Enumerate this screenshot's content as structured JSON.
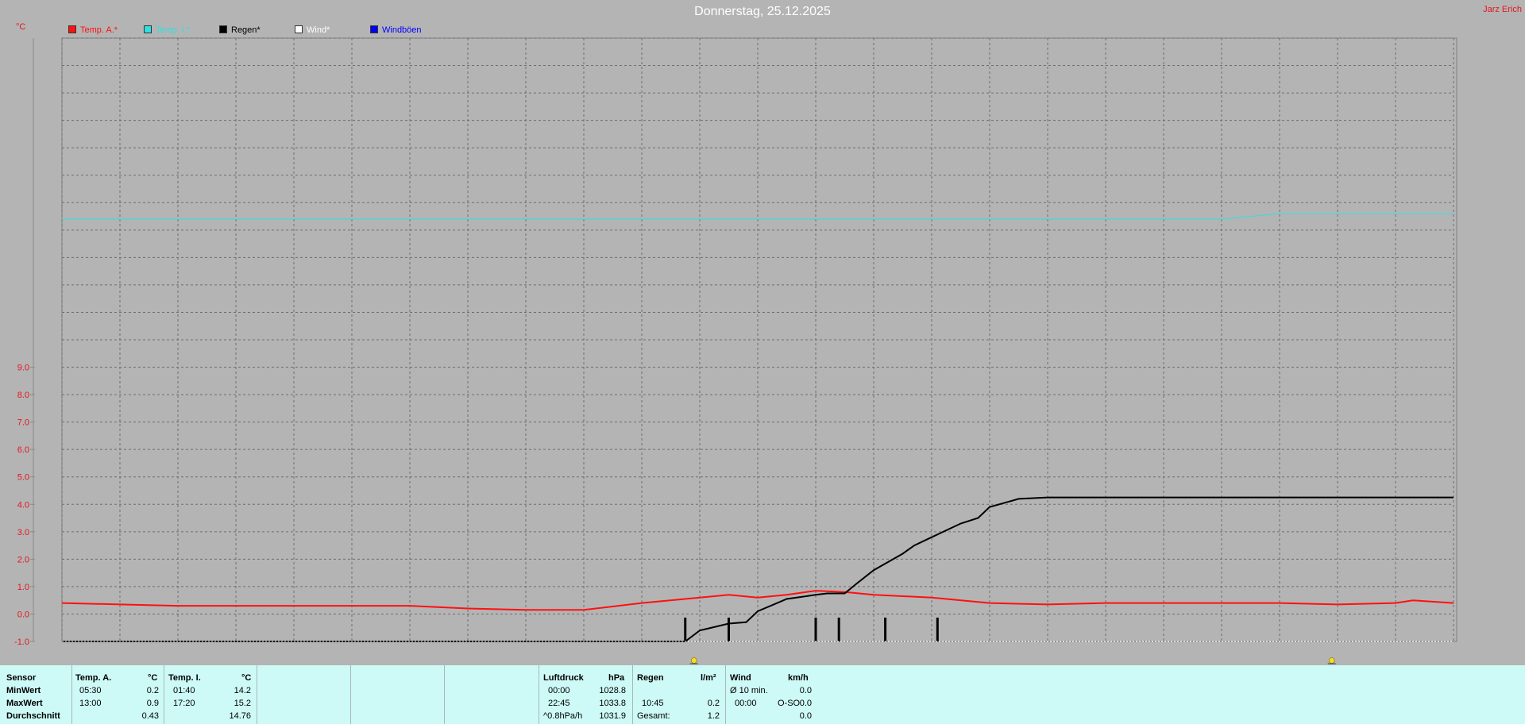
{
  "header": {
    "title": "Donnerstag, 25.12.2025",
    "corner_label": "Jarz Erich",
    "unit": "°C"
  },
  "legend": [
    {
      "label": "Temp. A.*",
      "color": "#ff1010"
    },
    {
      "label": "Temp. I.*",
      "color": "#30e0e0"
    },
    {
      "label": "Regen*",
      "color": "#000000"
    },
    {
      "label": "Wind*",
      "color": "#ffffff"
    },
    {
      "label": "Windböen",
      "color": "#0000ff"
    }
  ],
  "chart_data": {
    "type": "line",
    "ylim": [
      -1,
      21
    ],
    "xlim": [
      0,
      24
    ],
    "yticks": [
      -1,
      0,
      1,
      2,
      3,
      4,
      5,
      6,
      7,
      8,
      9
    ],
    "ytick_labels": [
      "-1.0",
      "0.0",
      "1.0",
      "2.0",
      "3.0",
      "4.0",
      "5.0",
      "6.0",
      "7.0",
      "8.0",
      "9.0"
    ],
    "grid": true,
    "series": [
      {
        "name": "Temp. A.*",
        "color": "#ff1010",
        "x": [
          0,
          1,
          2,
          3,
          4,
          5,
          6,
          7,
          8,
          9,
          10,
          11,
          11.5,
          12,
          12.5,
          13,
          13.5,
          14,
          14.5,
          15,
          16,
          17,
          18,
          19,
          20,
          21,
          22,
          23,
          23.3,
          24
        ],
        "y": [
          0.4,
          0.35,
          0.3,
          0.3,
          0.3,
          0.3,
          0.3,
          0.2,
          0.15,
          0.15,
          0.4,
          0.6,
          0.7,
          0.6,
          0.7,
          0.85,
          0.8,
          0.7,
          0.65,
          0.6,
          0.4,
          0.35,
          0.4,
          0.4,
          0.4,
          0.4,
          0.35,
          0.4,
          0.5,
          0.4
        ]
      },
      {
        "name": "Temp. I.*",
        "color": "#30e0e0",
        "x": [
          0,
          20,
          20.5,
          21,
          24
        ],
        "y": [
          14.4,
          14.4,
          14.5,
          14.6,
          14.6
        ]
      },
      {
        "name": "Regen*",
        "color": "#000000",
        "x": [
          0,
          10.75,
          11,
          11.5,
          11.8,
          12,
          12.5,
          13,
          13.2,
          13.5,
          13.7,
          14,
          14.5,
          14.7,
          15,
          15.5,
          15.8,
          16,
          16.5,
          17,
          24
        ],
        "y": [
          -1,
          -1,
          -0.6,
          -0.35,
          -0.3,
          0.1,
          0.55,
          0.7,
          0.75,
          0.75,
          1.1,
          1.6,
          2.2,
          2.5,
          2.8,
          3.3,
          3.5,
          3.9,
          4.2,
          4.25,
          4.25
        ]
      }
    ],
    "rain_bars_x": [
      10.75,
      11.5,
      13.0,
      13.4,
      14.2,
      15.1
    ],
    "markers": [
      {
        "name": "sunrise-icon",
        "x": 10.9
      },
      {
        "name": "sunset-icon",
        "x": 21.9
      }
    ]
  },
  "stats": {
    "sensor": {
      "header": "Sensor",
      "rows": [
        "MinWert",
        "MaxWert",
        "Durchschnitt"
      ]
    },
    "temp_a": {
      "header": "Temp. A.",
      "unit": "°C",
      "times": [
        "05:30",
        "13:00",
        ""
      ],
      "values": [
        "0.2",
        "0.9",
        "0.43"
      ]
    },
    "temp_i": {
      "header": "Temp. I.",
      "unit": "°C",
      "times": [
        "01:40",
        "17:20",
        ""
      ],
      "values": [
        "14.2",
        "15.2",
        "14.76"
      ]
    },
    "luftdruck": {
      "header": "Luftdruck",
      "unit": "hPa",
      "times": [
        "00:00",
        "22:45",
        "^0.8hPa/h"
      ],
      "values": [
        "1028.8",
        "1033.8",
        "1031.9"
      ]
    },
    "regen": {
      "header": "Regen",
      "unit": "l/m²",
      "times": [
        "",
        "10:45",
        "Gesamt:"
      ],
      "values": [
        "",
        "0.2",
        "1.2"
      ]
    },
    "wind": {
      "header": "Wind",
      "unit": "km/h",
      "times": [
        "Ø 10 min.",
        "00:00",
        ""
      ],
      "dirs": [
        "",
        "O-SO",
        ""
      ],
      "values": [
        "0.0",
        "0.0",
        "0.0"
      ]
    }
  }
}
